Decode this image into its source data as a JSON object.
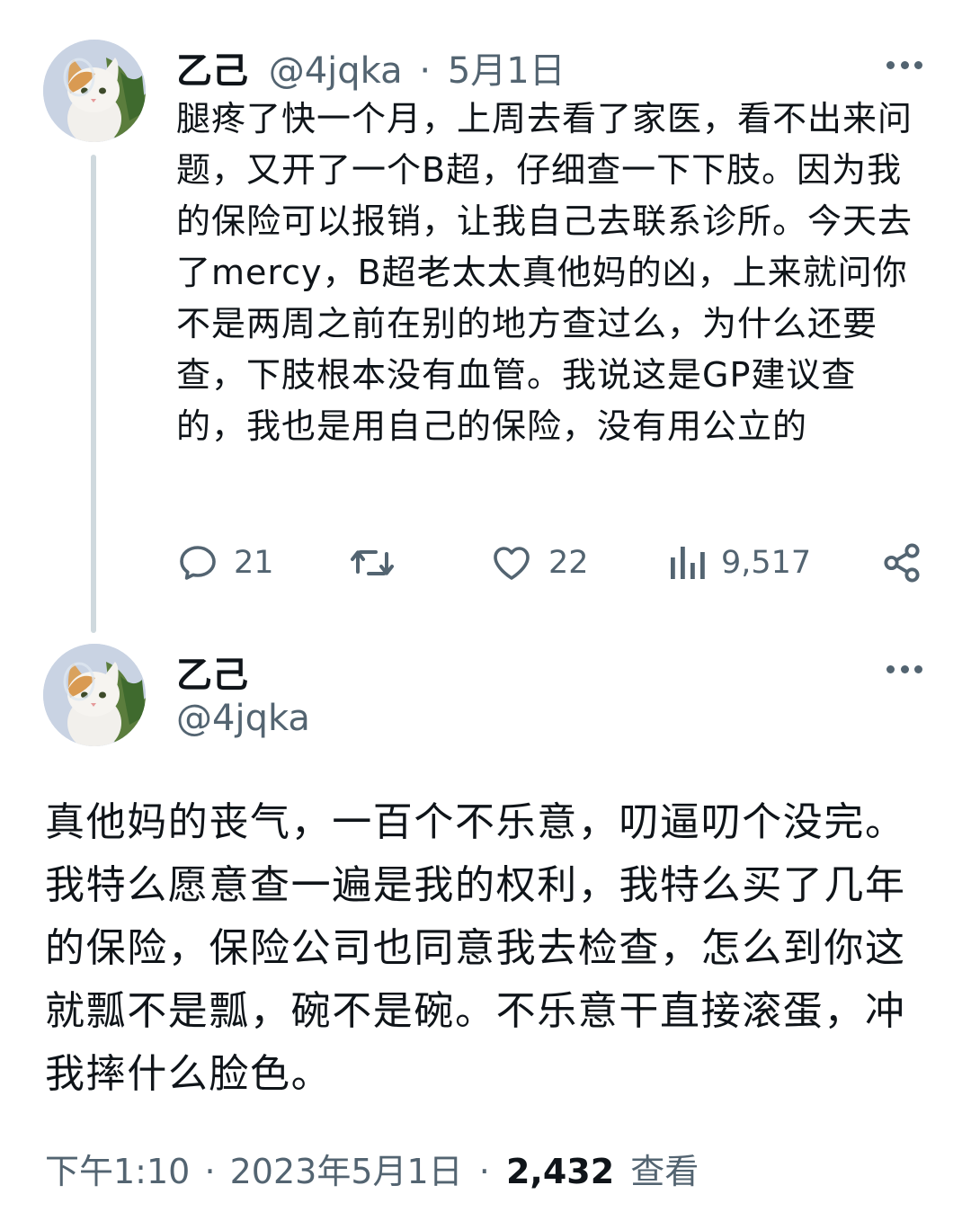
{
  "tweet1": {
    "display_name": "乙己",
    "handle": "@4jqka",
    "separator": "·",
    "date": "5月1日",
    "text": "腿疼了快一个月，上周去看了家医，看不出来问题，又开了一个B超，仔细查一下下肢。因为我的保险可以报销，让我自己去联系诊所。今天去了mercy，B超老太太真他妈的凶，上来就问你不是两周之前在别的地方查过么，为什么还要查，下肢根本没有血管。我说这是GP建议查的，我也是用自己的保险，没有用公立的",
    "actions": {
      "reply": {
        "icon": "reply-icon",
        "count": "21"
      },
      "retweet": {
        "icon": "retweet-icon",
        "count": ""
      },
      "like": {
        "icon": "heart-icon",
        "count": "22"
      },
      "views": {
        "icon": "views-chart-icon",
        "count": "9,517"
      },
      "share": {
        "icon": "share-icon"
      }
    }
  },
  "tweet2": {
    "display_name": "乙己",
    "handle": "@4jqka",
    "text": "真他妈的丧气，一百个不乐意，叨逼叨个没完。我特么愿意查一遍是我的权利，我特么买了几年的保险，保险公司也同意我去检查，怎么到你这就瓢不是瓢，碗不是碗。不乐意干直接滚蛋，冲我摔什么脸色。",
    "time": "下午1:10",
    "separator1": "·",
    "full_date": "2023年5月1日",
    "separator2": "·",
    "views_count": "2,432",
    "views_label": "查看"
  },
  "colors": {
    "text": "#0f1419",
    "muted": "#536471",
    "thread_line": "#cfd9de",
    "background": "#ffffff"
  }
}
